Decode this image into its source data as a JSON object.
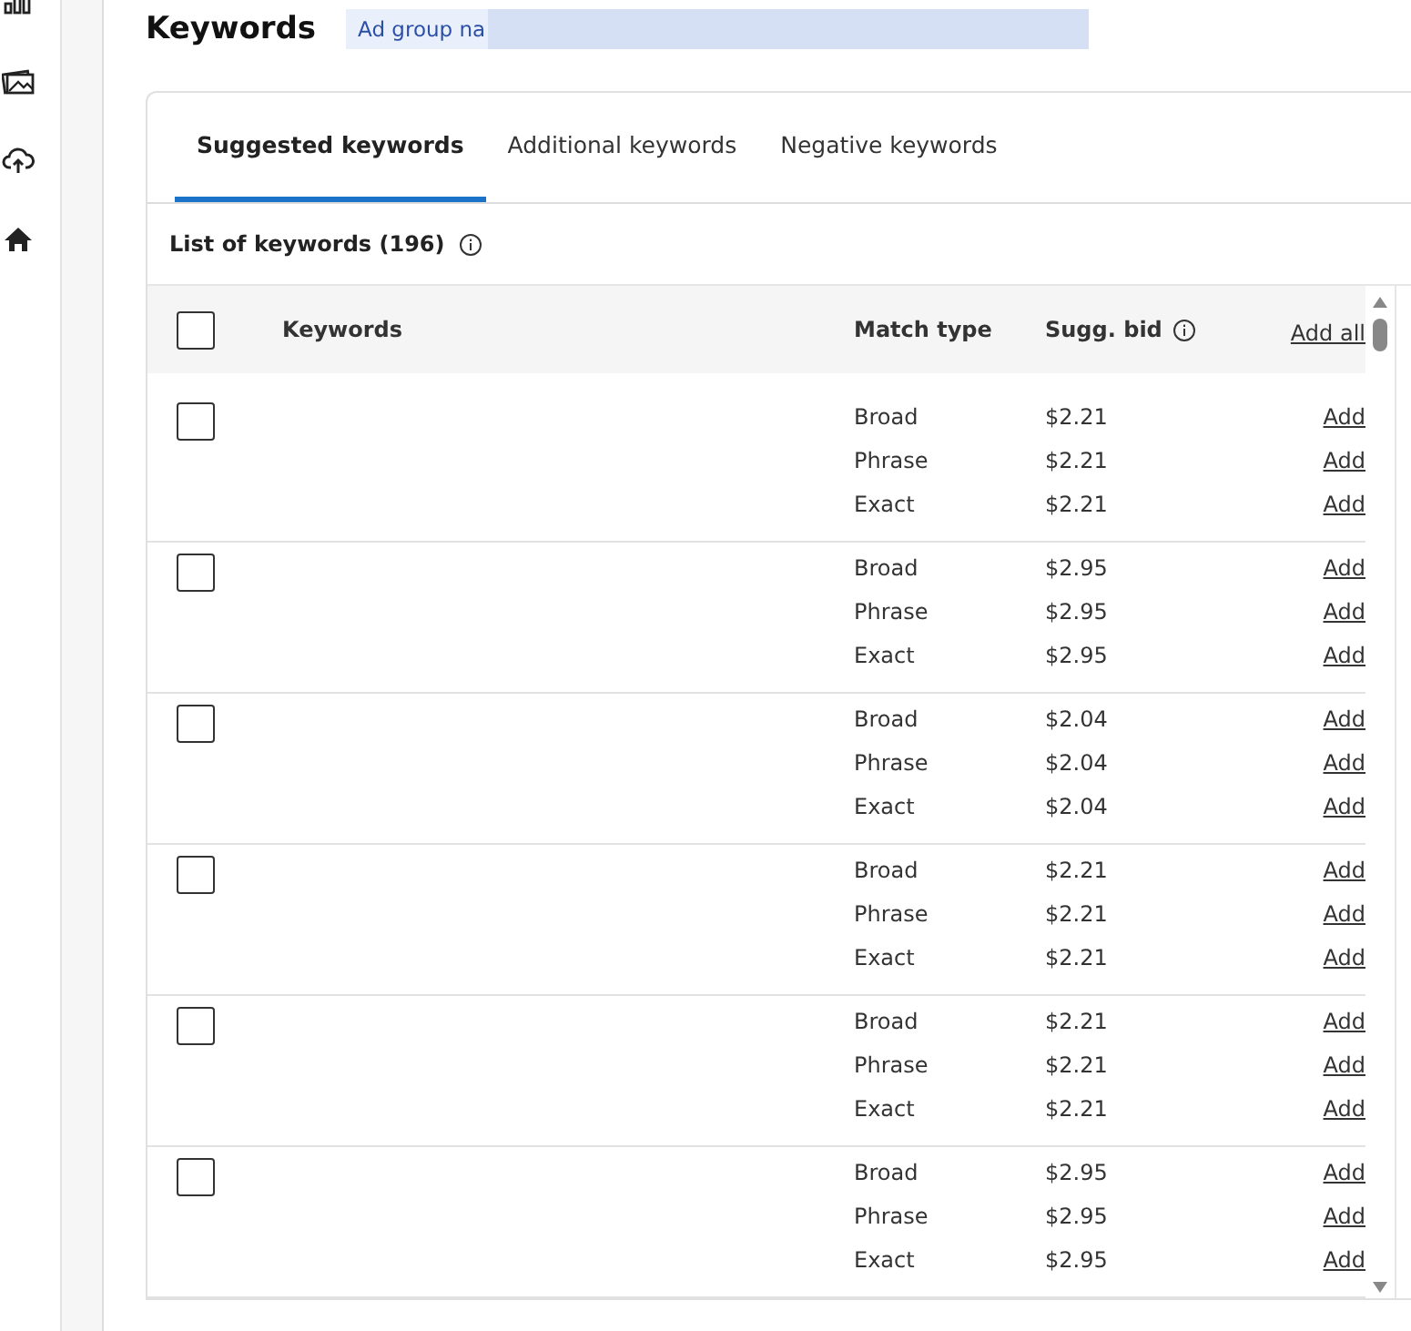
{
  "header": {
    "title": "Keywords",
    "ad_group_field": {
      "value": "Ad group na"
    }
  },
  "tabs": [
    {
      "label": "Suggested keywords",
      "selected": true
    },
    {
      "label": "Additional keywords",
      "selected": false
    },
    {
      "label": "Negative keywords",
      "selected": false
    }
  ],
  "list_title": "List of keywords (196)",
  "table": {
    "select_all": {
      "checked": false
    },
    "columns": [
      "Keywords",
      "Match type",
      "Sugg. bid"
    ],
    "add_all": "Add all",
    "rows": [
      {
        "checked": false,
        "options": [
          {
            "match": "Broad",
            "bid": "$2.21",
            "action": "Add"
          },
          {
            "match": "Phrase",
            "bid": "$2.21",
            "action": "Add"
          },
          {
            "match": "Exact",
            "bid": "$2.21",
            "action": "Add"
          }
        ]
      },
      {
        "checked": false,
        "options": [
          {
            "match": "Broad",
            "bid": "$2.95",
            "action": "Add"
          },
          {
            "match": "Phrase",
            "bid": "$2.95",
            "action": "Add"
          },
          {
            "match": "Exact",
            "bid": "$2.95",
            "action": "Add"
          }
        ]
      },
      {
        "checked": false,
        "options": [
          {
            "match": "Broad",
            "bid": "$2.04",
            "action": "Add"
          },
          {
            "match": "Phrase",
            "bid": "$2.04",
            "action": "Add"
          },
          {
            "match": "Exact",
            "bid": "$2.04",
            "action": "Add"
          }
        ]
      },
      {
        "checked": false,
        "options": [
          {
            "match": "Broad",
            "bid": "$2.21",
            "action": "Add"
          },
          {
            "match": "Phrase",
            "bid": "$2.21",
            "action": "Add"
          },
          {
            "match": "Exact",
            "bid": "$2.21",
            "action": "Add"
          }
        ]
      },
      {
        "checked": false,
        "options": [
          {
            "match": "Broad",
            "bid": "$2.21",
            "action": "Add"
          },
          {
            "match": "Phrase",
            "bid": "$2.21",
            "action": "Add"
          },
          {
            "match": "Exact",
            "bid": "$2.21",
            "action": "Add"
          }
        ]
      },
      {
        "checked": false,
        "options": [
          {
            "match": "Broad",
            "bid": "$2.95",
            "action": "Add"
          },
          {
            "match": "Phrase",
            "bid": "$2.95",
            "action": "Add"
          },
          {
            "match": "Exact",
            "bid": "$2.95",
            "action": "Add"
          }
        ]
      }
    ]
  }
}
